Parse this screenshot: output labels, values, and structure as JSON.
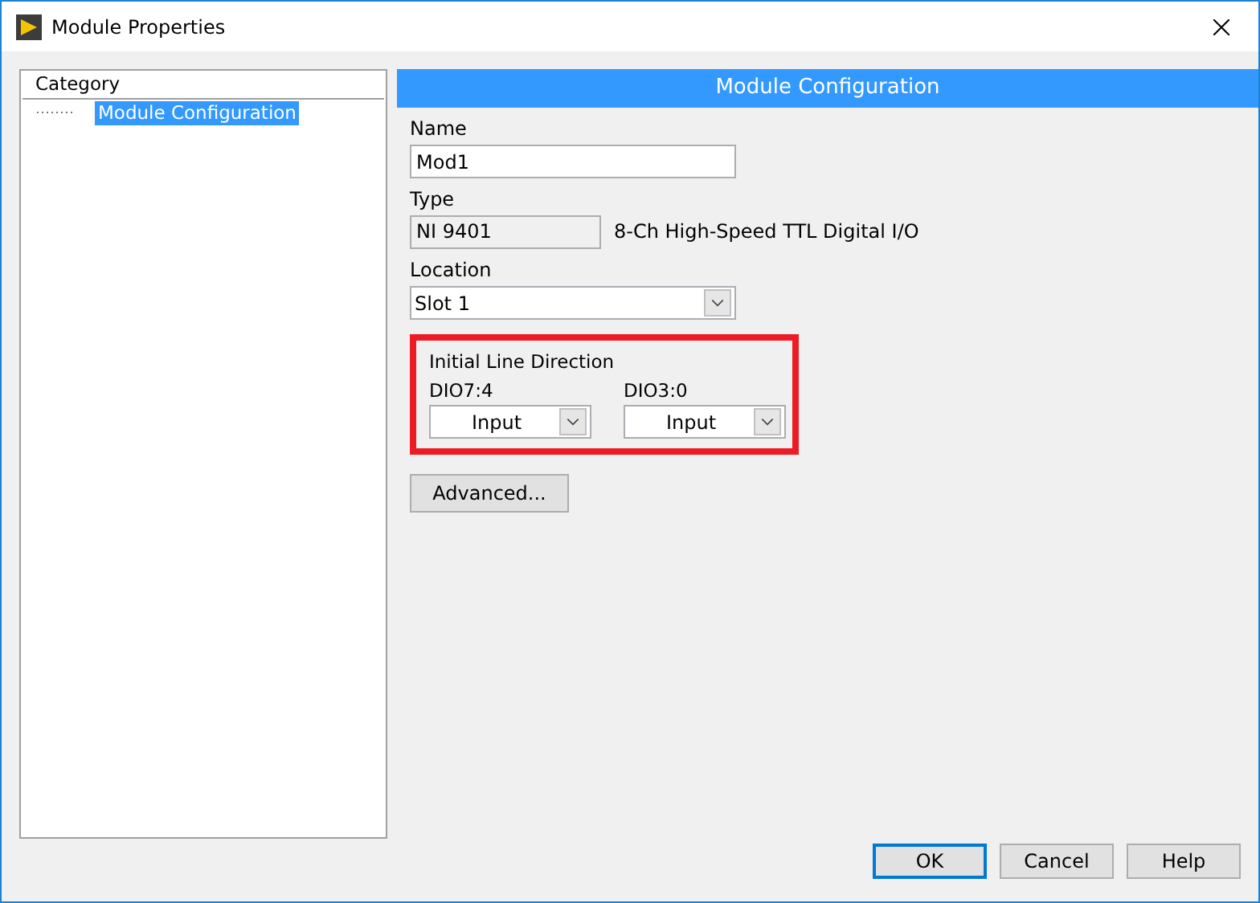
{
  "window": {
    "title": "Module Properties"
  },
  "category": {
    "header": "Category",
    "items": [
      {
        "label": "Module Configuration",
        "selected": true
      }
    ]
  },
  "panel": {
    "title": "Module Configuration",
    "name": {
      "label": "Name",
      "value": "Mod1"
    },
    "type": {
      "label": "Type",
      "value": "NI 9401",
      "description": "8-Ch High-Speed TTL Digital I/O"
    },
    "location": {
      "label": "Location",
      "value": "Slot 1"
    },
    "line_direction": {
      "title": "Initial Line Direction",
      "highlighted": true,
      "groups": [
        {
          "label": "DIO7:4",
          "value": "Input"
        },
        {
          "label": "DIO3:0",
          "value": "Input"
        }
      ]
    },
    "advanced_button": "Advanced..."
  },
  "buttons": [
    {
      "label": "OK",
      "default": true
    },
    {
      "label": "Cancel",
      "default": false
    },
    {
      "label": "Help",
      "default": false
    }
  ]
}
